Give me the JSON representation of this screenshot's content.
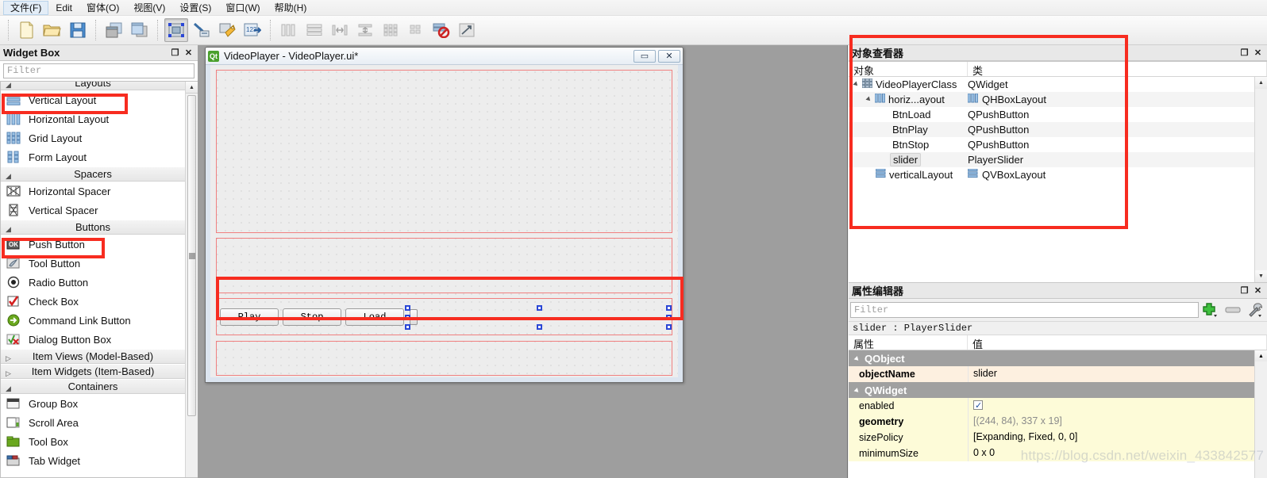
{
  "menubar": {
    "items": [
      {
        "label": "文件(F)",
        "active": true
      },
      {
        "label": "Edit",
        "active": false
      },
      {
        "label": "窗体(O)",
        "active": false
      },
      {
        "label": "视图(V)",
        "active": false
      },
      {
        "label": "设置(S)",
        "active": false
      },
      {
        "label": "窗口(W)",
        "active": false
      },
      {
        "label": "帮助(H)",
        "active": false
      }
    ]
  },
  "toolbar": {
    "groups": [
      {
        "icons": [
          {
            "name": "new-file-icon"
          },
          {
            "name": "open-file-icon"
          },
          {
            "name": "save-file-icon"
          }
        ]
      },
      {
        "icons": [
          {
            "name": "cascade-windows-icon"
          },
          {
            "name": "tile-windows-icon"
          }
        ]
      },
      {
        "icons": [
          {
            "name": "edit-widgets-icon",
            "pressed": true
          },
          {
            "name": "edit-signals-slots-icon"
          },
          {
            "name": "edit-buddies-icon"
          },
          {
            "name": "edit-tab-order-icon"
          }
        ]
      },
      {
        "icons": [
          {
            "name": "layout-horizontally-icon"
          },
          {
            "name": "layout-vertically-icon"
          },
          {
            "name": "layout-splitter-horizontal-icon"
          },
          {
            "name": "layout-splitter-vertical-icon"
          },
          {
            "name": "layout-grid-icon"
          },
          {
            "name": "layout-form-icon"
          },
          {
            "name": "break-layout-icon"
          },
          {
            "name": "adjust-size-icon"
          }
        ]
      }
    ]
  },
  "widget_box": {
    "title": "Widget Box",
    "undock_label": "❐",
    "close_label": "✕",
    "filter_placeholder": "Filter",
    "sections": [
      {
        "name": "Layouts",
        "expanded": true,
        "items": [
          {
            "label": "Vertical Layout",
            "icon": "vertical-layout-icon",
            "highlighted": true
          },
          {
            "label": "Horizontal Layout",
            "icon": "horizontal-layout-icon"
          },
          {
            "label": "Grid Layout",
            "icon": "grid-layout-icon"
          },
          {
            "label": "Form Layout",
            "icon": "form-layout-icon"
          }
        ]
      },
      {
        "name": "Spacers",
        "expanded": true,
        "items": [
          {
            "label": "Horizontal Spacer",
            "icon": "horizontal-spacer-icon"
          },
          {
            "label": "Vertical Spacer",
            "icon": "vertical-spacer-icon"
          }
        ]
      },
      {
        "name": "Buttons",
        "expanded": true,
        "items": [
          {
            "label": "Push Button",
            "icon": "push-button-icon",
            "highlighted": true
          },
          {
            "label": "Tool Button",
            "icon": "tool-button-icon"
          },
          {
            "label": "Radio Button",
            "icon": "radio-button-icon"
          },
          {
            "label": "Check Box",
            "icon": "check-box-icon"
          },
          {
            "label": "Command Link Button",
            "icon": "command-link-button-icon"
          },
          {
            "label": "Dialog Button Box",
            "icon": "dialog-button-box-icon"
          }
        ]
      },
      {
        "name": "Item Views (Model-Based)",
        "expanded": false,
        "items": []
      },
      {
        "name": "Item Widgets (Item-Based)",
        "expanded": false,
        "items": []
      },
      {
        "name": "Containers",
        "expanded": true,
        "items": [
          {
            "label": "Group Box",
            "icon": "group-box-icon"
          },
          {
            "label": "Scroll Area",
            "icon": "scroll-area-icon"
          },
          {
            "label": "Tool Box",
            "icon": "tool-box-icon"
          },
          {
            "label": "Tab Widget",
            "icon": "tab-widget-icon"
          }
        ]
      }
    ]
  },
  "form_window": {
    "title": "VideoPlayer - VideoPlayer.ui*",
    "logo_text": "Qt",
    "minimize_label": "▭",
    "close_label": "✕",
    "buttons": [
      {
        "label": "Play",
        "name": "play-button"
      },
      {
        "label": "Stop",
        "name": "stop-button"
      },
      {
        "label": "Load",
        "name": "load-button"
      }
    ],
    "selected_widget": "slider"
  },
  "object_inspector": {
    "title": "对象查看器",
    "undock_label": "❐",
    "close_label": "✕",
    "columns": [
      "对象",
      "类"
    ],
    "rows": [
      {
        "object": "VideoPlayerClass",
        "class": "QWidget",
        "depth": 0,
        "icon": "widget-icon",
        "expander": true,
        "selected": false
      },
      {
        "object": "horiz...ayout",
        "class": "QHBoxLayout",
        "depth": 1,
        "icon": "hbox-layout-icon",
        "class_icon": "hbox-layout-icon",
        "expander": true,
        "selected": false
      },
      {
        "object": "BtnLoad",
        "class": "QPushButton",
        "depth": 2,
        "icon": "",
        "selected": false
      },
      {
        "object": "BtnPlay",
        "class": "QPushButton",
        "depth": 2,
        "icon": "",
        "selected": false
      },
      {
        "object": "BtnStop",
        "class": "QPushButton",
        "depth": 2,
        "icon": "",
        "selected": false
      },
      {
        "object": "slider",
        "class": "PlayerSlider",
        "depth": 2,
        "icon": "",
        "selected": true
      },
      {
        "object": "verticalLayout",
        "class": "QVBoxLayout",
        "depth": 1,
        "icon": "vbox-layout-icon",
        "class_icon": "vbox-layout-icon",
        "expander": false,
        "selected": false
      }
    ]
  },
  "property_editor": {
    "title": "属性编辑器",
    "undock_label": "❐",
    "close_label": "✕",
    "filter_placeholder": "Filter",
    "add_button": "add-property-icon",
    "remove_button": "remove-property-icon",
    "configure_button": "configure-icon",
    "object_line": "slider : PlayerSlider",
    "columns": [
      "属性",
      "值"
    ],
    "rows": [
      {
        "kind": "group",
        "name": "QObject"
      },
      {
        "kind": "name",
        "name": "objectName",
        "value": "slider",
        "bold": true,
        "expandable": false
      },
      {
        "kind": "group",
        "name": "QWidget"
      },
      {
        "kind": "prop",
        "name": "enabled",
        "value": "",
        "checkbox": true,
        "expandable": false
      },
      {
        "kind": "prop",
        "name": "geometry",
        "value": "[(244, 84), 337 x 19]",
        "bold": true,
        "grey": true,
        "expandable": true
      },
      {
        "kind": "prop",
        "name": "sizePolicy",
        "value": "[Expanding, Fixed, 0, 0]",
        "expandable": true
      },
      {
        "kind": "prop",
        "name": "minimumSize",
        "value": "0 x 0",
        "expandable": true
      }
    ]
  },
  "watermark": {
    "text": "https://blog.csdn.net/weixin_433842577"
  },
  "colors": {
    "highlight_red": "#f72c20",
    "mdi_background": "#9e9e9e",
    "selection_blue": "#2b47d6",
    "layout_outline": "#f08080",
    "group_header": "#a0a0a0",
    "name_row": "#fdf0e0",
    "value_row": "#fdfbd8"
  }
}
